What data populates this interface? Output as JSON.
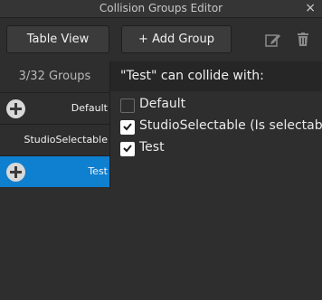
{
  "window": {
    "title": "Collision Groups Editor",
    "close_glyph": "×"
  },
  "toolbar": {
    "table_view_label": "Table View",
    "add_group_label": "+ Add Group",
    "icons": [
      "edit-icon",
      "trash-icon"
    ]
  },
  "left_panel": {
    "group_count": "3/32 Groups",
    "groups": [
      {
        "label": "Default",
        "has_add_icon": true,
        "selected": false
      },
      {
        "label": "StudioSelectable",
        "has_add_icon": false,
        "selected": false
      },
      {
        "label": "Test",
        "has_add_icon": true,
        "selected": true
      }
    ]
  },
  "right_panel": {
    "header": "\"Test\" can collide with:",
    "options": [
      {
        "label": "Default",
        "checked": false
      },
      {
        "label": "StudioSelectable (Is selectable in",
        "checked": true
      },
      {
        "label": "Test",
        "checked": true
      }
    ]
  },
  "colors": {
    "background": "#2e2e2e",
    "selected": "#0f7fd0",
    "header": "#262626"
  }
}
